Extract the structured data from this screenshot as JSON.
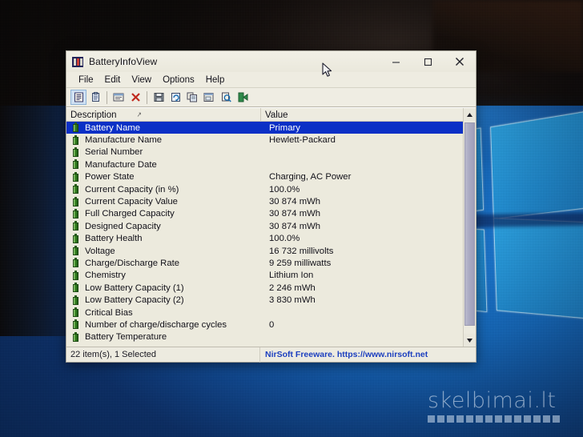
{
  "window": {
    "title": "BatteryInfoView",
    "icon": "battery-app-icon",
    "controls": {
      "minimize_label": "Minimize",
      "maximize_label": "Maximize",
      "close_label": "Close"
    }
  },
  "menubar": {
    "items": [
      {
        "label": "File"
      },
      {
        "label": "Edit"
      },
      {
        "label": "View"
      },
      {
        "label": "Options"
      },
      {
        "label": "Help"
      }
    ]
  },
  "toolbar": {
    "buttons": [
      {
        "name": "properties-icon",
        "glyph": "≡",
        "active": true
      },
      {
        "name": "clipboard-icon",
        "glyph": "ὌB",
        "active": false
      },
      {
        "name": "html-report-icon",
        "glyph": "▤",
        "active": false
      },
      {
        "name": "delete-icon",
        "glyph": "✕",
        "active": false
      },
      {
        "name": "save-icon",
        "glyph": "ὋE",
        "active": false
      },
      {
        "name": "refresh-icon",
        "glyph": "↻",
        "active": false
      },
      {
        "name": "copy-icon",
        "glyph": "⧉",
        "active": false
      },
      {
        "name": "properties-window-icon",
        "glyph": "▣",
        "active": false
      },
      {
        "name": "find-icon",
        "glyph": "ὐD",
        "active": false
      },
      {
        "name": "exit-icon",
        "glyph": "↪",
        "active": false
      }
    ]
  },
  "listview": {
    "columns": [
      {
        "label": "Description",
        "sort_indicator": "↗"
      },
      {
        "label": "Value",
        "sort_indicator": ""
      }
    ],
    "rows": [
      {
        "description": "Battery Name",
        "value": "Primary",
        "selected": true
      },
      {
        "description": "Manufacture Name",
        "value": "Hewlett-Packard",
        "selected": false
      },
      {
        "description": "Serial Number",
        "value": "",
        "selected": false
      },
      {
        "description": "Manufacture Date",
        "value": "",
        "selected": false
      },
      {
        "description": "Power State",
        "value": "Charging, AC Power",
        "selected": false
      },
      {
        "description": "Current Capacity (in %)",
        "value": "100.0%",
        "selected": false
      },
      {
        "description": "Current Capacity Value",
        "value": "30 874 mWh",
        "selected": false
      },
      {
        "description": "Full Charged Capacity",
        "value": "30 874 mWh",
        "selected": false
      },
      {
        "description": "Designed Capacity",
        "value": "30 874 mWh",
        "selected": false
      },
      {
        "description": "Battery Health",
        "value": "100.0%",
        "selected": false
      },
      {
        "description": "Voltage",
        "value": "16 732 millivolts",
        "selected": false
      },
      {
        "description": "Charge/Discharge Rate",
        "value": "9 259 milliwatts",
        "selected": false
      },
      {
        "description": "Chemistry",
        "value": "Lithium Ion",
        "selected": false
      },
      {
        "description": "Low Battery Capacity (1)",
        "value": "2 246 mWh",
        "selected": false
      },
      {
        "description": "Low Battery Capacity (2)",
        "value": "3 830 mWh",
        "selected": false
      },
      {
        "description": "Critical Bias",
        "value": "",
        "selected": false
      },
      {
        "description": "Number of charge/discharge cycles",
        "value": "0",
        "selected": false
      },
      {
        "description": "Battery Temperature",
        "value": "",
        "selected": false
      }
    ]
  },
  "scrollbar": {
    "up_glyph": "▲",
    "down_glyph": "▼"
  },
  "statusbar": {
    "left": "22 item(s), 1 Selected",
    "right": "NirSoft Freeware. https://www.nirsoft.net"
  },
  "watermark": {
    "text": "skelbimai.lt",
    "square_count": 14
  },
  "colors": {
    "selection_blue": "#0b30c6",
    "status_link_blue": "#1c3fbf",
    "window_face": "#eceadd",
    "battery_green": "#2f7a1e",
    "wallpaper_blue": "#1878d4"
  }
}
